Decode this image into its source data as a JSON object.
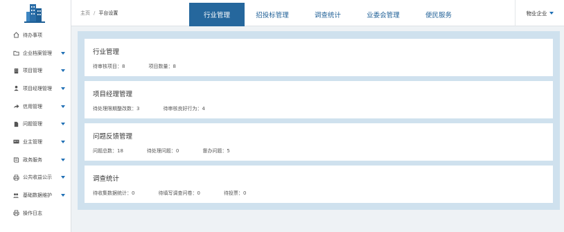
{
  "sidebar": {
    "items": [
      {
        "label": "待办事项",
        "icon": "home-icon",
        "has_caret": false
      },
      {
        "label": "企业档案管理",
        "icon": "folder-icon",
        "has_caret": true
      },
      {
        "label": "项目管理",
        "icon": "building-icon",
        "has_caret": true
      },
      {
        "label": "项目经理管理",
        "icon": "user-icon",
        "has_caret": true
      },
      {
        "label": "信用管理",
        "icon": "share-icon",
        "has_caret": true
      },
      {
        "label": "问题管理",
        "icon": "file-icon",
        "has_caret": true
      },
      {
        "label": "业主管理",
        "icon": "id-card-icon",
        "has_caret": true
      },
      {
        "label": "政务服务",
        "icon": "book-icon",
        "has_caret": true
      },
      {
        "label": "公共收益公示",
        "icon": "print-icon",
        "has_caret": true
      },
      {
        "label": "基础数据维护",
        "icon": "users-icon",
        "has_caret": true
      },
      {
        "label": "操作日志",
        "icon": "print-icon",
        "has_caret": false
      }
    ]
  },
  "breadcrumb": {
    "home": "主页",
    "separator": "/",
    "current": "平台设置"
  },
  "tabs": [
    {
      "label": "行业管理",
      "active": true
    },
    {
      "label": "招投标管理",
      "active": false
    },
    {
      "label": "调查统计",
      "active": false
    },
    {
      "label": "业委会管理",
      "active": false
    },
    {
      "label": "便民服务",
      "active": false
    }
  ],
  "user": {
    "label": "物业企业"
  },
  "cards": [
    {
      "title": "行业管理",
      "stats": [
        {
          "label": "待审核项目：",
          "value": "8"
        },
        {
          "label": "项目数量：",
          "value": "8"
        }
      ]
    },
    {
      "title": "项目经理管理",
      "stats": [
        {
          "label": "待处理限期整改数：",
          "value": "3"
        },
        {
          "label": "待审核良好行为：",
          "value": "4"
        }
      ]
    },
    {
      "title": "问题反馈管理",
      "stats": [
        {
          "label": "问题总数：",
          "value": "18"
        },
        {
          "label": "待处理问题：",
          "value": "0"
        },
        {
          "label": "督办问题：",
          "value": "5"
        }
      ]
    },
    {
      "title": "调查统计",
      "stats": [
        {
          "label": "待收集数据统计：",
          "value": "0"
        },
        {
          "label": "待填写调查问卷：",
          "value": "0"
        },
        {
          "label": "待投票：",
          "value": "0"
        }
      ]
    }
  ],
  "colors": {
    "accent": "#25679d",
    "tab_text": "#1e5f96",
    "content_bg": "#cfe1ee",
    "page_bg": "#eef2f5"
  }
}
